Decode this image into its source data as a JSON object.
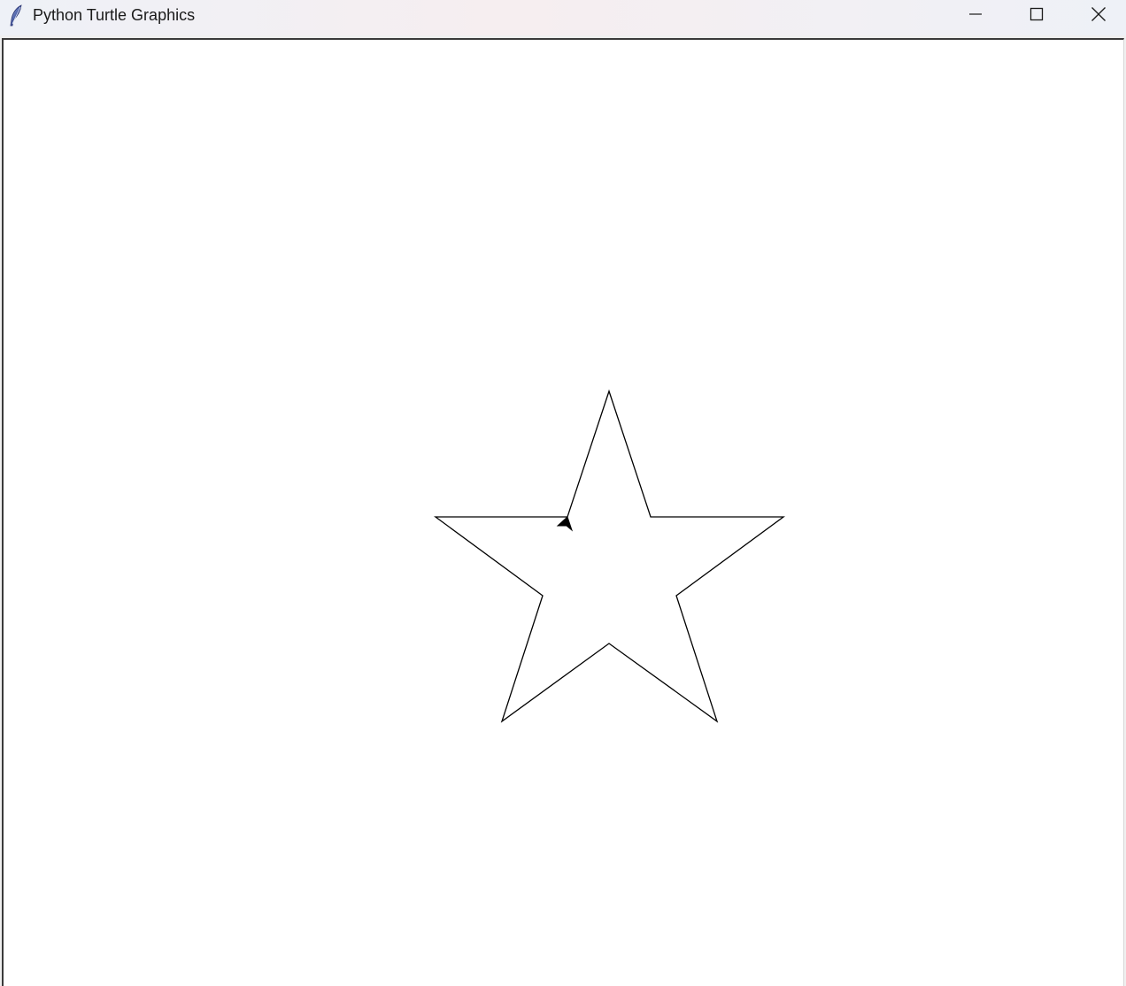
{
  "window": {
    "title": "Python Turtle Graphics",
    "icon": "tk-feather-icon",
    "controls": {
      "minimize_icon": "minimize-icon",
      "maximize_icon": "maximize-icon",
      "close_icon": "close-icon"
    }
  },
  "canvas": {
    "background": "#ffffff",
    "pen_color": "#000000",
    "shape": "five-pointed star outline",
    "turtle_shape": "classic arrow"
  }
}
